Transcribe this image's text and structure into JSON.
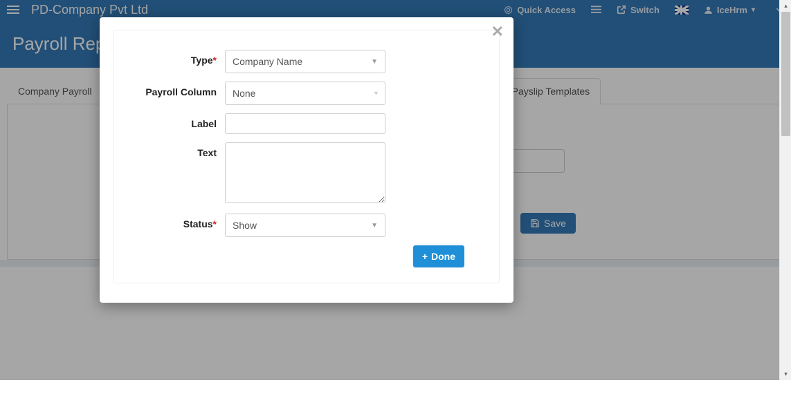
{
  "navbar": {
    "brand": "PD-Company Pvt Ltd",
    "quick_access": "Quick Access",
    "switch": "Switch",
    "user": "IceHrm"
  },
  "page": {
    "title": "Payroll Repo"
  },
  "tabs": {
    "company_payroll": "Company Payroll",
    "payslip_templates": "Payslip Templates"
  },
  "buttons": {
    "save": "Save",
    "done": "Done"
  },
  "modal": {
    "fields": {
      "type": {
        "label": "Type",
        "value": "Company Name"
      },
      "payroll_column": {
        "label": "Payroll Column",
        "value": "None"
      },
      "label": {
        "label": "Label",
        "value": ""
      },
      "text": {
        "label": "Text",
        "value": ""
      },
      "status": {
        "label": "Status",
        "value": "Show"
      }
    }
  }
}
